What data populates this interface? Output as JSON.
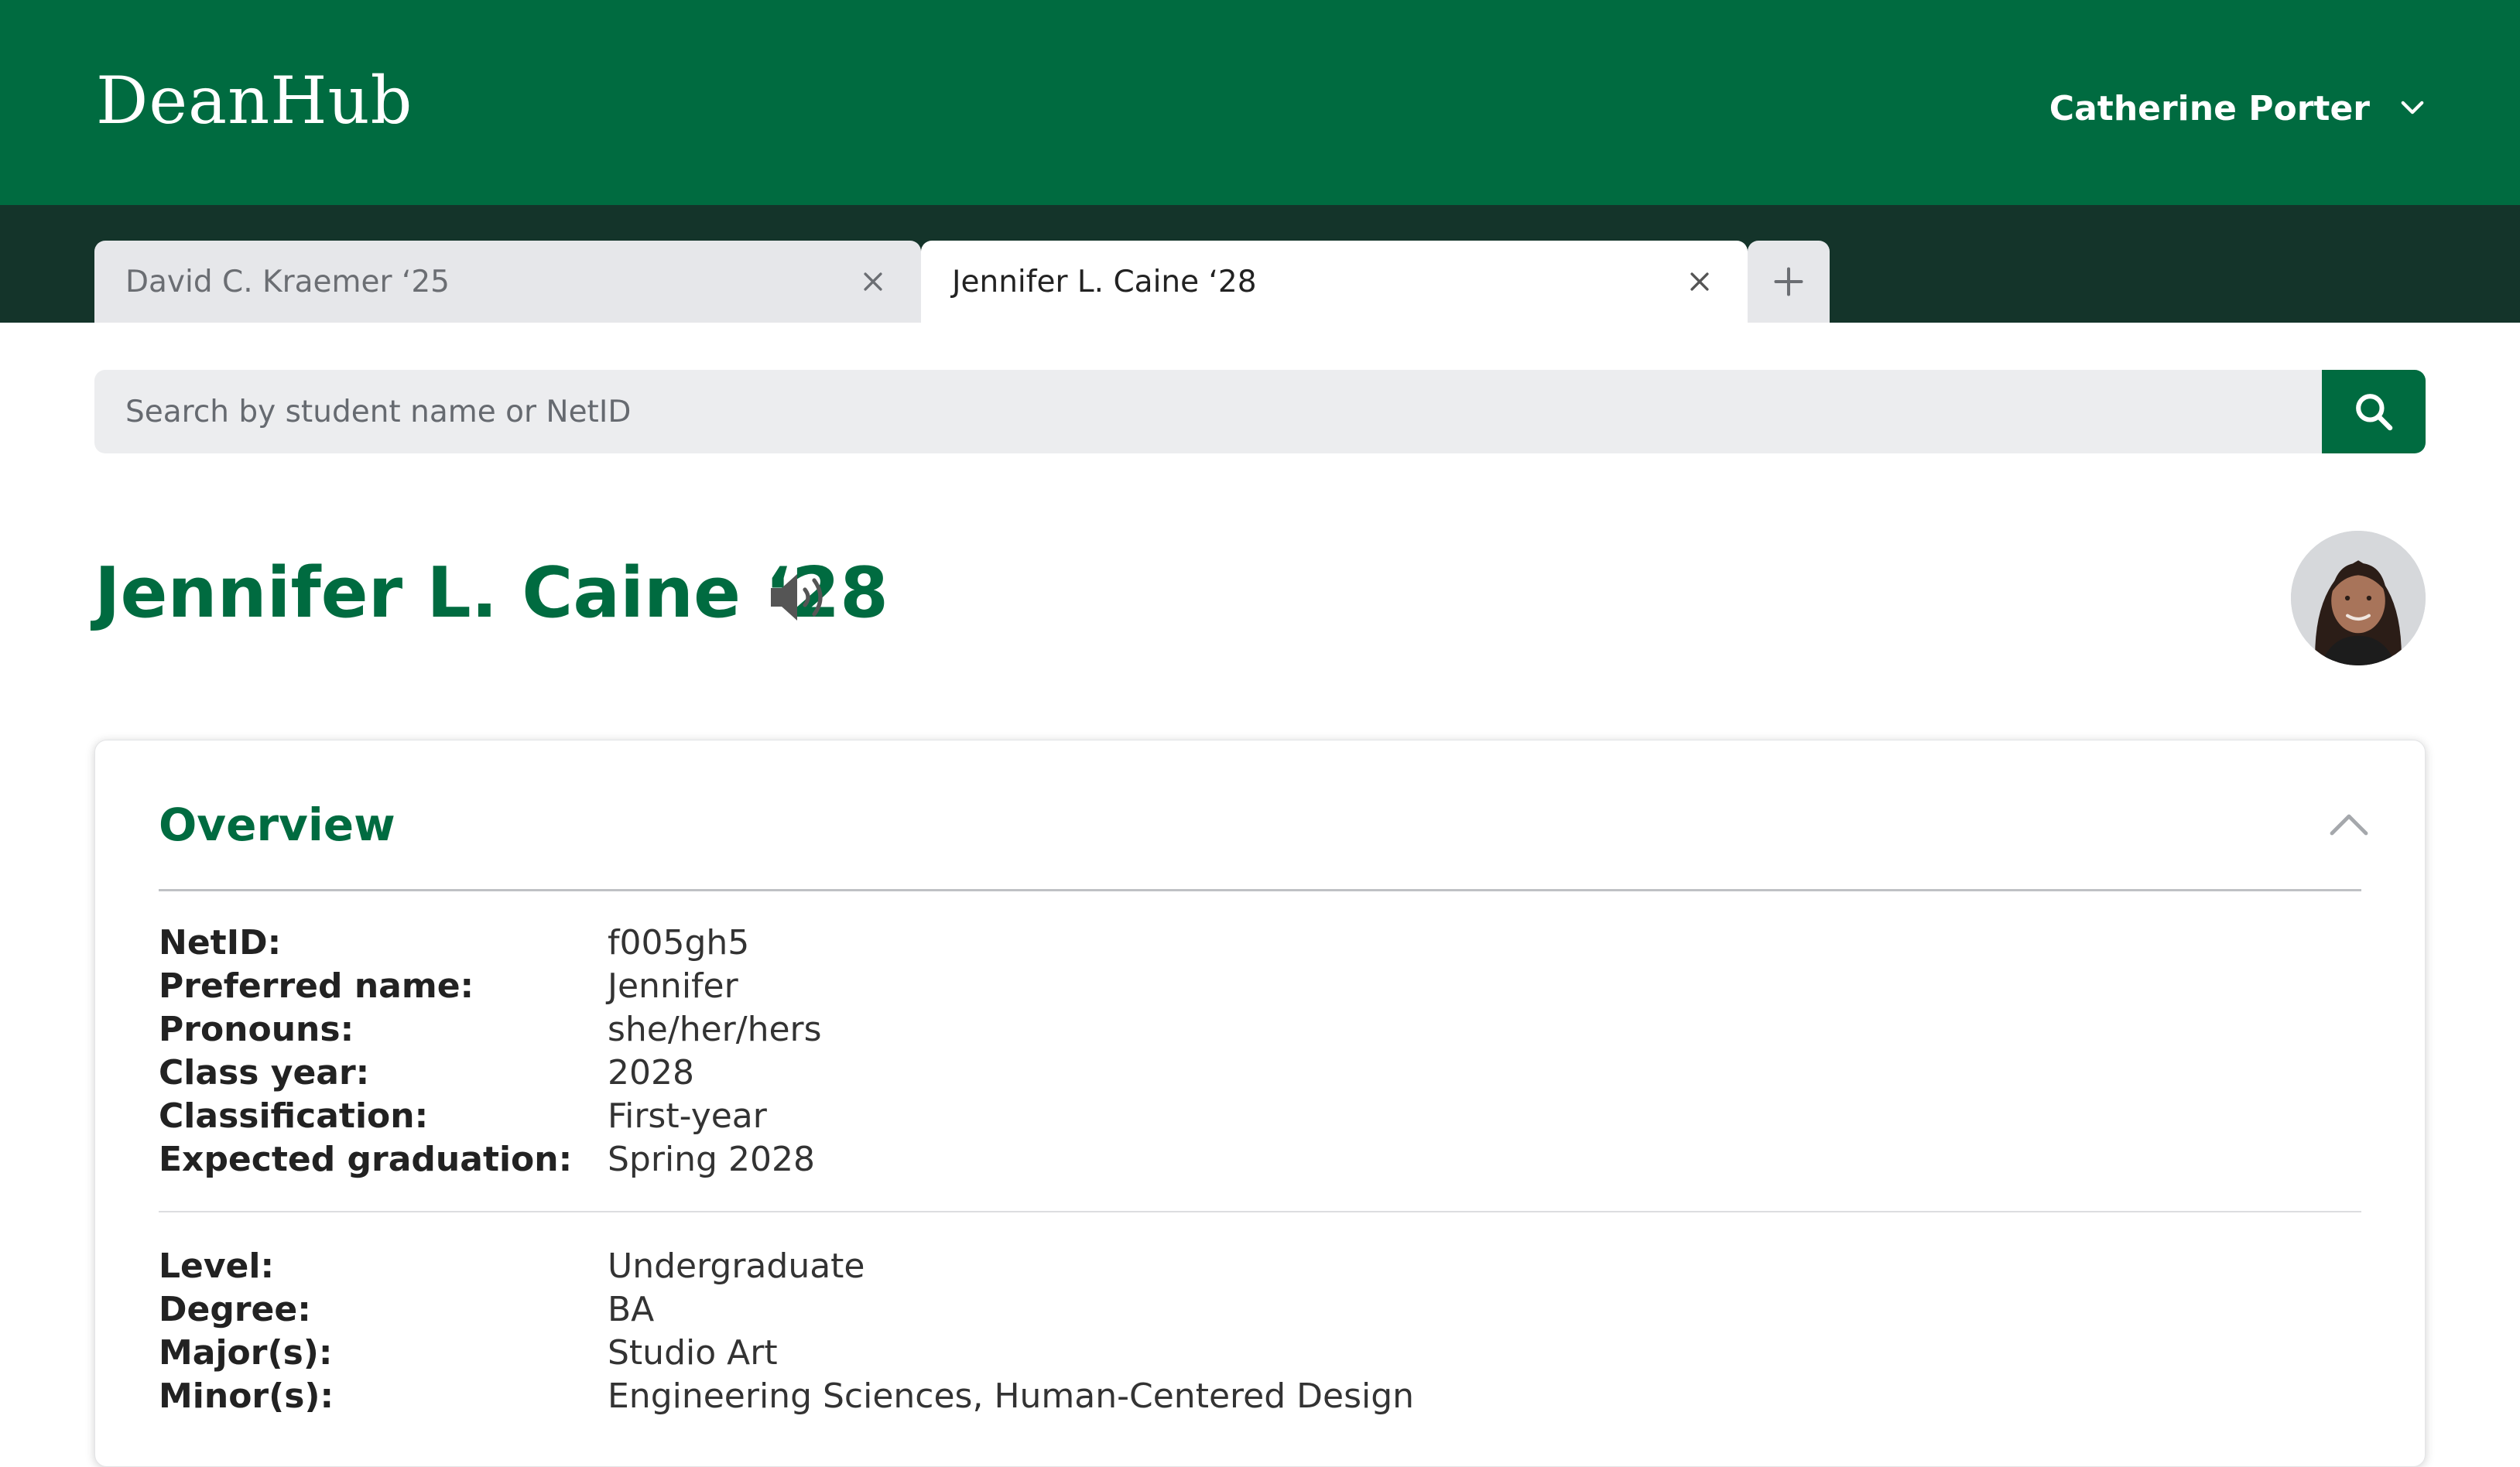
{
  "header": {
    "brand": "DeanHub",
    "user_name": "Catherine Porter",
    "background_color": "#006b40"
  },
  "tabs": [
    {
      "label": "David C. Kraemer ‘25",
      "active": false
    },
    {
      "label": "Jennifer L. Caine ‘28",
      "active": true
    }
  ],
  "search": {
    "placeholder": "Search by student name or NetID",
    "value": ""
  },
  "student": {
    "name": "Jennifer L. Caine ‘28"
  },
  "overview": {
    "title": "Overview",
    "group1": [
      {
        "label": "NetID:",
        "value": "f005gh5"
      },
      {
        "label": "Preferred name:",
        "value": "Jennifer"
      },
      {
        "label": "Pronouns:",
        "value": "she/her/hers"
      },
      {
        "label": "Class year:",
        "value": "2028"
      },
      {
        "label": "Classification:",
        "value": "First-year"
      },
      {
        "label": "Expected graduation:",
        "value": "Spring 2028"
      }
    ],
    "group2": [
      {
        "label": "Level:",
        "value": "Undergraduate"
      },
      {
        "label": "Degree:",
        "value": "BA"
      },
      {
        "label": "Major(s):",
        "value": "Studio Art"
      },
      {
        "label": "Minor(s):",
        "value": "Engineering Sciences, Human-Centered Design"
      }
    ]
  },
  "icons": {
    "user_menu": "chevron-down-icon",
    "tab_close": "close-icon",
    "tab_add": "plus-icon",
    "search": "search-icon",
    "pronunciation": "speaker-icon",
    "collapse": "chevron-up-icon"
  },
  "colors": {
    "brand_green": "#006b40",
    "tab_strip": "#14342a",
    "inactive_tab": "#e6e7ea"
  }
}
